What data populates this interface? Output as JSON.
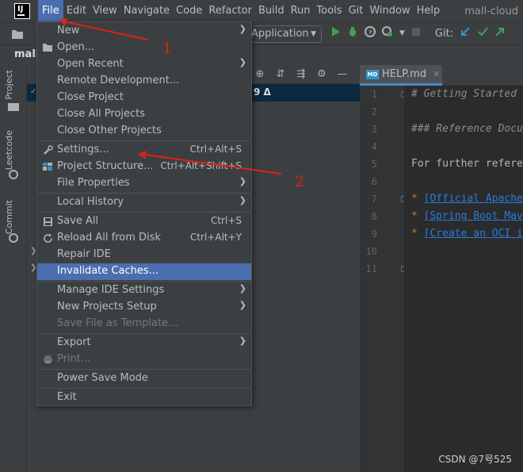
{
  "menubar": {
    "items": [
      "File",
      "Edit",
      "View",
      "Navigate",
      "Code",
      "Refactor",
      "Build",
      "Run",
      "Tools",
      "Git",
      "Window",
      "Help"
    ],
    "window_title": "mall-cloud"
  },
  "toolbar": {
    "run_config": "Application",
    "git_label": "Git:"
  },
  "navbar": {
    "project_crumb": "mall"
  },
  "left_stripe": {
    "tabs": [
      "Project",
      "Leetcode",
      "Commit"
    ]
  },
  "project_panel": {
    "changes_badge": "9 Δ"
  },
  "editor": {
    "tab_label": "HELP.md",
    "tab_icon": "MD",
    "line_numbers": [
      "1",
      "2",
      "3",
      "4",
      "5",
      "6",
      "7",
      "8",
      "9",
      "10",
      "11"
    ],
    "lines": {
      "l1": "# Getting Started",
      "l3": "### Reference Docu",
      "l5": "For further refere",
      "l7_bullet": "* ",
      "l7_link": "[Official Apache",
      "l8_bullet": "* ",
      "l8_link": "[Spring Boot Mav",
      "l9_bullet": "* ",
      "l9_link": "[Create an OCI i"
    }
  },
  "file_menu": {
    "new": "New",
    "open": "Open...",
    "open_recent": "Open Recent",
    "remote_development": "Remote Development...",
    "close_project": "Close Project",
    "close_all_projects": "Close All Projects",
    "close_other_projects": "Close Other Projects",
    "settings": "Settings...",
    "settings_shortcut": "Ctrl+Alt+S",
    "project_structure": "Project Structure...",
    "project_structure_shortcut": "Ctrl+Alt+Shift+S",
    "file_properties": "File Properties",
    "local_history": "Local History",
    "save_all": "Save All",
    "save_all_shortcut": "Ctrl+S",
    "reload_all": "Reload All from Disk",
    "reload_all_shortcut": "Ctrl+Alt+Y",
    "repair_ide": "Repair IDE",
    "invalidate_caches": "Invalidate Caches...",
    "manage_ide_settings": "Manage IDE Settings",
    "new_projects_setup": "New Projects Setup",
    "save_as_template": "Save File as Template...",
    "export": "Export",
    "print": "Print...",
    "power_save_mode": "Power Save Mode",
    "exit": "Exit"
  },
  "annotations": {
    "label_1": "1",
    "label_2": "2",
    "color": "#e0201c"
  },
  "watermark": "CSDN @7号525",
  "colors": {
    "accent": "#4b6eaf",
    "menu_bg": "#3c3f41",
    "editor_bg": "#2b2b2b"
  }
}
